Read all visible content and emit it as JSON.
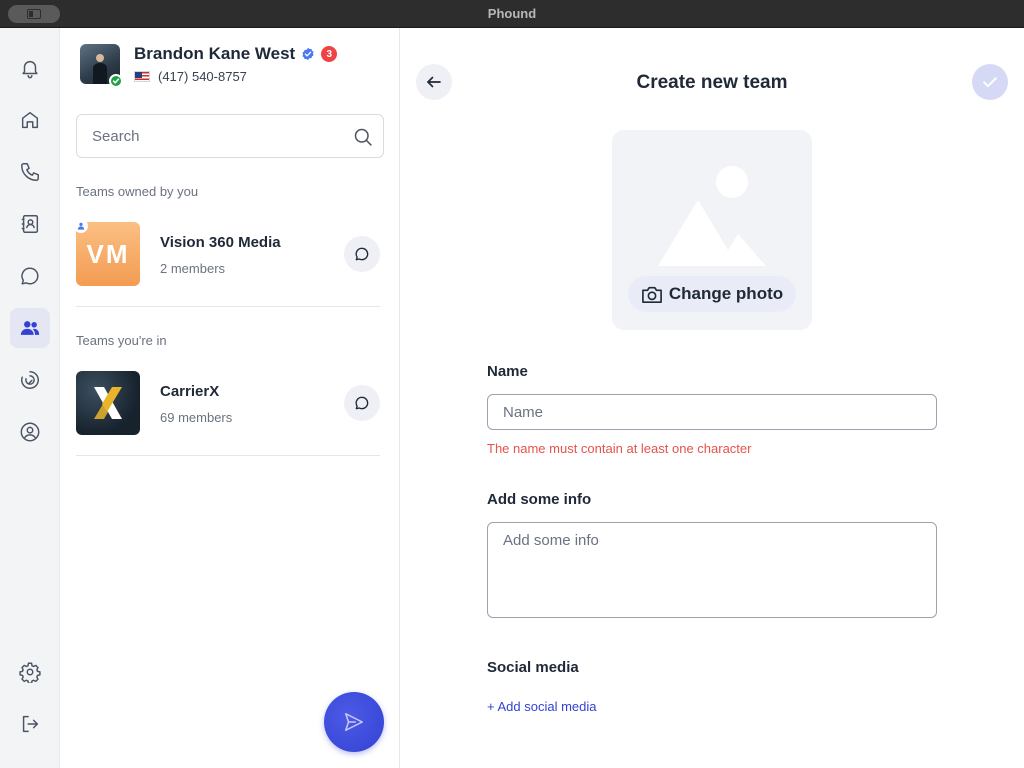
{
  "window": {
    "title": "Phound"
  },
  "rail": {
    "items": [
      {
        "icon": "bell-icon",
        "name": "rail-notifications"
      },
      {
        "icon": "home-icon",
        "name": "rail-home"
      },
      {
        "icon": "phone-icon",
        "name": "rail-calls"
      },
      {
        "icon": "contacts-icon",
        "name": "rail-contacts"
      },
      {
        "icon": "chat-icon",
        "name": "rail-messages"
      },
      {
        "icon": "team-icon",
        "name": "rail-teams",
        "active": true
      },
      {
        "icon": "circular-arrow-icon",
        "name": "rail-activity"
      },
      {
        "icon": "user-circle-icon",
        "name": "rail-profile"
      },
      {
        "icon": "gear-icon",
        "name": "rail-settings"
      },
      {
        "icon": "logout-icon",
        "name": "rail-logout"
      }
    ]
  },
  "profile": {
    "name": "Brandon Kane West",
    "verified": true,
    "notification_count": "3",
    "phone": "(417) 540-8757",
    "status_color": "#22a045"
  },
  "search": {
    "placeholder": "Search"
  },
  "sections": {
    "owned_label": "Teams owned by you",
    "member_label": "Teams you're in"
  },
  "teams_owned": [
    {
      "initials": "VM",
      "name": "Vision 360 Media",
      "members": "2 members"
    }
  ],
  "teams_in": [
    {
      "name": "CarrierX",
      "members": "69 members"
    }
  ],
  "form": {
    "title": "Create new team",
    "change_photo_label": "Change photo",
    "name_label": "Name",
    "name_placeholder": "Name",
    "name_value": "",
    "name_error": "The name must contain at least one character",
    "info_label": "Add some info",
    "info_placeholder": "Add some info",
    "info_value": "",
    "social_label": "Social media",
    "add_social_label": "+ Add social media"
  },
  "colors": {
    "accent": "#3442d4",
    "error": "#e5534b",
    "confirm_disabled": "#d6d9f6"
  }
}
